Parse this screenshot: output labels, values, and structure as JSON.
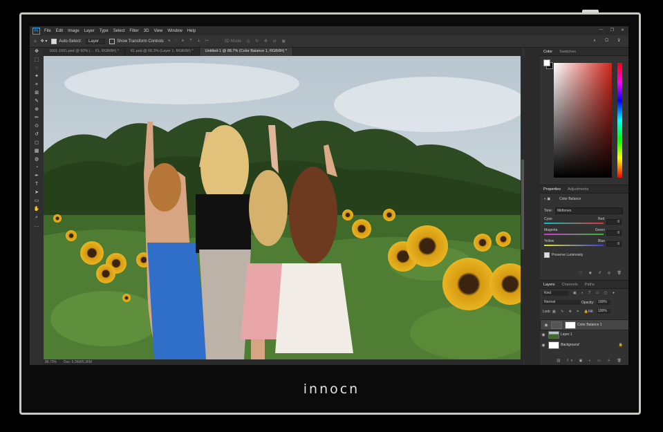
{
  "brand": "innocn",
  "menu": {
    "logo": "Ps",
    "items": [
      "File",
      "Edit",
      "Image",
      "Layer",
      "Type",
      "Select",
      "Filter",
      "3D",
      "View",
      "Window",
      "Help"
    ],
    "window_controls": [
      "—",
      "❐",
      "✕"
    ]
  },
  "options_bar": {
    "auto_select_label": "Auto-Select:",
    "auto_select_value": "Layer",
    "transform_label": "Show Transform Controls",
    "mode_3d": "3D Mode:"
  },
  "doc_tabs": [
    {
      "label": "1601-1601.psd @ 50% (… 61, RGB/8#) *",
      "active": false
    },
    {
      "label": "61.psb @ 66.3% (Layer 1, RGB/8#) *",
      "active": false
    },
    {
      "label": "Untitled-1 @ 88.7% (Color Balance 1, RGB/8#) *",
      "active": true
    }
  ],
  "toolbar_icons": [
    "move-icon",
    "marquee-icon",
    "lasso-icon",
    "magic-wand-icon",
    "crop-icon",
    "frame-icon",
    "eyedropper-icon",
    "healing-icon",
    "brush-icon",
    "stamp-icon",
    "history-brush-icon",
    "eraser-icon",
    "gradient-icon",
    "blur-icon",
    "dodge-icon",
    "pen-icon",
    "type-icon",
    "path-select-icon",
    "shape-icon",
    "hand-icon",
    "zoom-icon",
    "more-icon"
  ],
  "toolbar_glyphs": [
    "✥",
    "⬚",
    "◌",
    "✦",
    "⌗",
    "⊠",
    "✎",
    "⊕",
    "✏",
    "⊙",
    "↺",
    "◻",
    "▦",
    "◍",
    "◔",
    "✒",
    "T",
    "➤",
    "▭",
    "✋",
    "⌕",
    "…"
  ],
  "status": {
    "zoom": "88.73%",
    "doc": "Doc: 5.36M/5.36M"
  },
  "color_panel": {
    "tabs": [
      "Color",
      "Swatches"
    ]
  },
  "properties": {
    "tabs": [
      "Properties",
      "Adjustments"
    ],
    "title": "Color Balance",
    "tone_label": "Tone:",
    "tone_value": "Midtones",
    "sliders": [
      {
        "left": "Cyan",
        "right": "Red",
        "value": "0",
        "colors": [
          "#00c8c8",
          "#e83030"
        ]
      },
      {
        "left": "Magenta",
        "right": "Green",
        "value": "0",
        "colors": [
          "#e030e0",
          "#30c030"
        ]
      },
      {
        "left": "Yellow",
        "right": "Blue",
        "value": "0",
        "colors": [
          "#e8e030",
          "#3040e8"
        ]
      }
    ],
    "preserve_label": "Preserve Luminosity"
  },
  "layers": {
    "tabs": [
      "Layers",
      "Channels",
      "Paths"
    ],
    "kind": "Kind",
    "blend": "Normal",
    "opacity_label": "Opacity:",
    "opacity": "100%",
    "lock_label": "Lock:",
    "fill_label": "Fill:",
    "fill": "100%",
    "items": [
      {
        "name": "Color Balance 1",
        "selected": true
      },
      {
        "name": "Layer 1",
        "selected": false
      },
      {
        "name": "Background",
        "selected": false
      }
    ]
  }
}
